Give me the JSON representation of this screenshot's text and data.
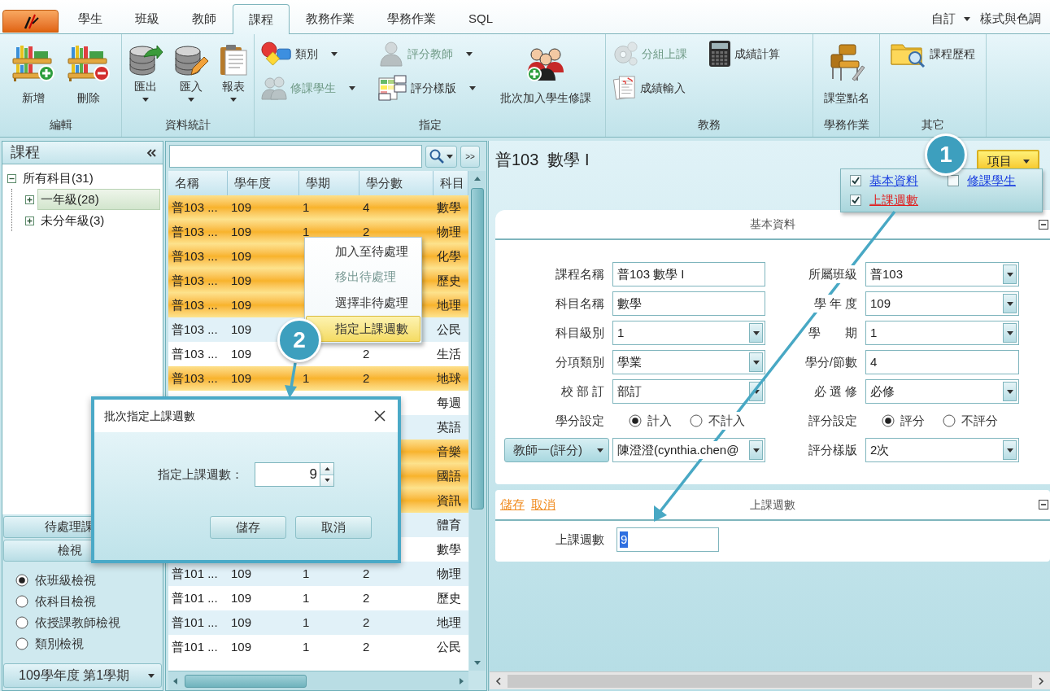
{
  "tabs": [
    {
      "label": "學生",
      "selected": false
    },
    {
      "label": "班級",
      "selected": false
    },
    {
      "label": "教師",
      "selected": false
    },
    {
      "label": "課程",
      "selected": true
    },
    {
      "label": "教務作業",
      "selected": false
    },
    {
      "label": "學務作業",
      "selected": false
    },
    {
      "label": "SQL",
      "selected": false
    }
  ],
  "top_right": {
    "customize": "自訂",
    "style": "樣式與色調"
  },
  "ribbon": [
    {
      "title": "編輯",
      "items": [
        {
          "kind": "large",
          "label": "新增",
          "dropdown": false,
          "disabled": false
        },
        {
          "kind": "large",
          "label": "刪除",
          "dropdown": false,
          "disabled": false
        }
      ]
    },
    {
      "title": "資料統計",
      "items": [
        {
          "kind": "large",
          "label": "匯出",
          "dropdown": true,
          "disabled": false
        },
        {
          "kind": "large",
          "label": "匯入",
          "dropdown": true,
          "disabled": false
        },
        {
          "kind": "large",
          "label": "報表",
          "dropdown": true,
          "disabled": false
        }
      ]
    },
    {
      "title": "指定",
      "items": [
        {
          "kind": "small",
          "label": "類別",
          "dropdown": true,
          "disabled": false
        },
        {
          "kind": "small",
          "label": "修課學生",
          "dropdown": true,
          "disabled": true
        },
        {
          "kind": "small",
          "label": "評分教師",
          "dropdown": true,
          "disabled": true
        },
        {
          "kind": "small",
          "label": "評分樣版",
          "dropdown": true,
          "disabled": false
        },
        {
          "kind": "large",
          "label": "批次加入學生修課",
          "dropdown": false,
          "disabled": false
        }
      ]
    },
    {
      "title": "教務",
      "items": [
        {
          "kind": "small",
          "label": "分組上課",
          "dropdown": false,
          "disabled": true
        },
        {
          "kind": "small",
          "label": "成績輸入",
          "dropdown": false,
          "disabled": false
        },
        {
          "kind": "small",
          "label": "成績計算",
          "dropdown": false,
          "disabled": false
        }
      ]
    },
    {
      "title": "學務作業",
      "items": [
        {
          "kind": "large",
          "label": "課堂點名",
          "dropdown": false,
          "disabled": false
        }
      ]
    },
    {
      "title": "其它",
      "items": [
        {
          "kind": "small",
          "label": "課程歷程",
          "dropdown": false,
          "disabled": false
        }
      ]
    }
  ],
  "sidebar": {
    "title": "課程",
    "tree": [
      {
        "label": "所有科目(31)",
        "expanded": true,
        "selected": false,
        "children": [
          {
            "label": "一年級(28)",
            "expanded": false,
            "selected": true
          },
          {
            "label": "未分年級(3)",
            "expanded": false,
            "selected": false
          }
        ]
      }
    ],
    "pending_button": "待處理課",
    "view_button": "檢視",
    "view_options": [
      {
        "label": "依班級檢視",
        "selected": true
      },
      {
        "label": "依科目檢視",
        "selected": false
      },
      {
        "label": "依授課教師檢視",
        "selected": false
      },
      {
        "label": "類別檢視",
        "selected": false
      }
    ],
    "semester": "109學年度 第1學期"
  },
  "search_panel": {
    "expand_button": ">>"
  },
  "table": {
    "columns": [
      "名稱",
      "學年度",
      "學期",
      "學分數",
      "科目"
    ],
    "rows": [
      {
        "selected": true,
        "name": "普103 ...",
        "year": "109",
        "term": "1",
        "credits": "4",
        "subject": "數學"
      },
      {
        "selected": true,
        "name": "普103 ...",
        "year": "109",
        "term": "1",
        "credits": "2",
        "subject": "物理"
      },
      {
        "selected": true,
        "name": "普103 ...",
        "year": "109",
        "subject": "化學"
      },
      {
        "selected": true,
        "name": "普103 ...",
        "year": "109",
        "subject": "歷史"
      },
      {
        "selected": true,
        "name": "普103 ...",
        "year": "109",
        "subject": "地理"
      },
      {
        "selected": false,
        "name": "普103 ...",
        "year": "109",
        "subject": "公民"
      },
      {
        "selected": false,
        "name": "普103 ...",
        "year": "109",
        "credits": "2",
        "subject": "生活"
      },
      {
        "selected": true,
        "name": "普103 ...",
        "year": "109",
        "term": "1",
        "credits": "2",
        "subject": "地球"
      },
      {
        "selected": false,
        "subject": "每週"
      },
      {
        "selected": false,
        "subject": "英語"
      },
      {
        "selected": true,
        "subject": "音樂"
      },
      {
        "selected": true,
        "subject": "國語"
      },
      {
        "selected": true,
        "subject": "資訊"
      },
      {
        "selected": false,
        "subject": "體育"
      },
      {
        "selected": false,
        "subject": "數學"
      },
      {
        "selected": false,
        "name": "普101 ...",
        "year": "109",
        "term": "1",
        "credits": "2",
        "subject": "物理"
      },
      {
        "selected": false,
        "name": "普101 ...",
        "year": "109",
        "term": "1",
        "credits": "2",
        "subject": "歷史"
      },
      {
        "selected": false,
        "name": "普101 ...",
        "year": "109",
        "term": "1",
        "credits": "2",
        "subject": "地理"
      },
      {
        "selected": false,
        "name": "普101 ...",
        "year": "109",
        "term": "1",
        "credits": "2",
        "subject": "公民"
      }
    ]
  },
  "context_menu": [
    {
      "label": "加入至待處理",
      "disabled": false,
      "selected": false
    },
    {
      "label": "移出待處理",
      "disabled": true,
      "selected": false
    },
    {
      "label": "選擇非待處理",
      "disabled": false,
      "selected": false
    },
    {
      "label": "指定上課週數",
      "disabled": false,
      "selected": true
    }
  ],
  "callouts": [
    {
      "number": "1"
    },
    {
      "number": "2"
    }
  ],
  "dialog": {
    "title": "批次指定上課週數",
    "label": "指定上課週數：",
    "value": "9",
    "buttons": [
      "儲存",
      "取消"
    ]
  },
  "detail": {
    "title": "普103  數學 I",
    "items_button": "項目",
    "sections": [
      {
        "label": "基本資料",
        "checked": true,
        "selected": false
      },
      {
        "label": "修課學生",
        "checked": false,
        "selected": false
      },
      {
        "label": "上課週數",
        "checked": true,
        "selected": true
      }
    ]
  },
  "basic_info": {
    "title": "基本資料",
    "fields": [
      {
        "kind": "text",
        "label": "課程名稱",
        "value": "普103 數學 I"
      },
      {
        "kind": "combo",
        "label": "所屬班級",
        "value": "普103"
      },
      {
        "kind": "text",
        "label": "科目名稱",
        "value": "數學"
      },
      {
        "kind": "combo",
        "label": "學 年 度",
        "value": "109"
      },
      {
        "kind": "combo",
        "label": "科目級別",
        "value": "1"
      },
      {
        "kind": "combo",
        "label": "學　　期",
        "value": "1"
      },
      {
        "kind": "combo",
        "label": "分項類別",
        "value": "學業"
      },
      {
        "kind": "text",
        "label": "學分/節數",
        "value": "4"
      },
      {
        "kind": "combo",
        "label": "校 部 訂",
        "value": "部訂"
      },
      {
        "kind": "combo",
        "label": "必 選 修",
        "value": "必修"
      },
      {
        "kind": "radio",
        "label": "學分設定",
        "options": [
          {
            "label": "計入",
            "selected": true
          },
          {
            "label": "不計入",
            "selected": false
          }
        ]
      },
      {
        "kind": "radio",
        "label": "評分設定",
        "options": [
          {
            "label": "評分",
            "selected": true
          },
          {
            "label": "不評分",
            "selected": false
          }
        ]
      },
      {
        "kind": "picker",
        "label": "教師一(評分)",
        "value": "陳澄澄(cynthia.chen@"
      },
      {
        "kind": "combo",
        "label": "評分樣版",
        "value": "2次"
      }
    ]
  },
  "weeks": {
    "title": "上課週數",
    "links": [
      "儲存",
      "取消"
    ],
    "label": "上課週數",
    "value": "9",
    "value_highlighted": true
  }
}
